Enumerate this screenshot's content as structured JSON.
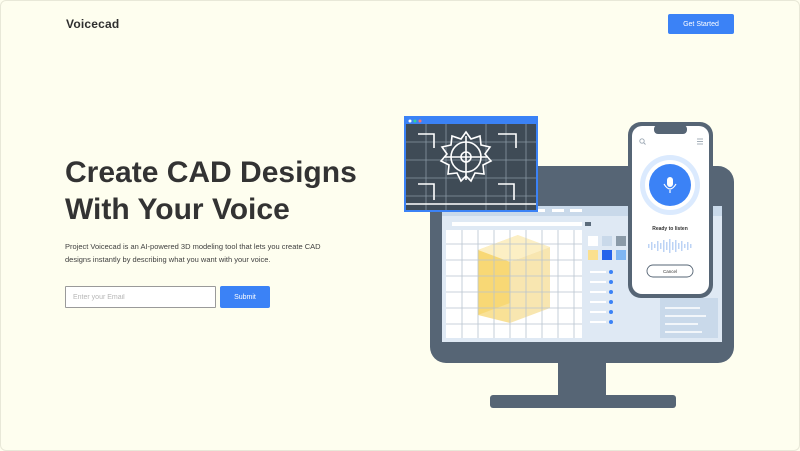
{
  "brand": {
    "name": "Voicecad"
  },
  "header": {
    "cta_label": "Get Started"
  },
  "hero": {
    "headline_line1": "Create CAD Designs",
    "headline_line2": "With Your Voice",
    "description": "Project Voicecad is an AI-powered 3D modeling tool that lets you create CAD designs instantly by describing what you want with your voice.",
    "email_placeholder": "Enter your Email",
    "submit_label": "Submit"
  },
  "illustration": {
    "phone_status": "Ready to listen",
    "phone_cancel_label": "Cancel",
    "microphone_icon": "microphone-icon",
    "search_icon": "search-icon",
    "menu_icon": "hamburger-icon"
  },
  "colors": {
    "background": "#fefeef",
    "accent": "#3b82f6",
    "headline": "#333333",
    "monitor": "#566575",
    "blueprint": "#3f4b56"
  }
}
